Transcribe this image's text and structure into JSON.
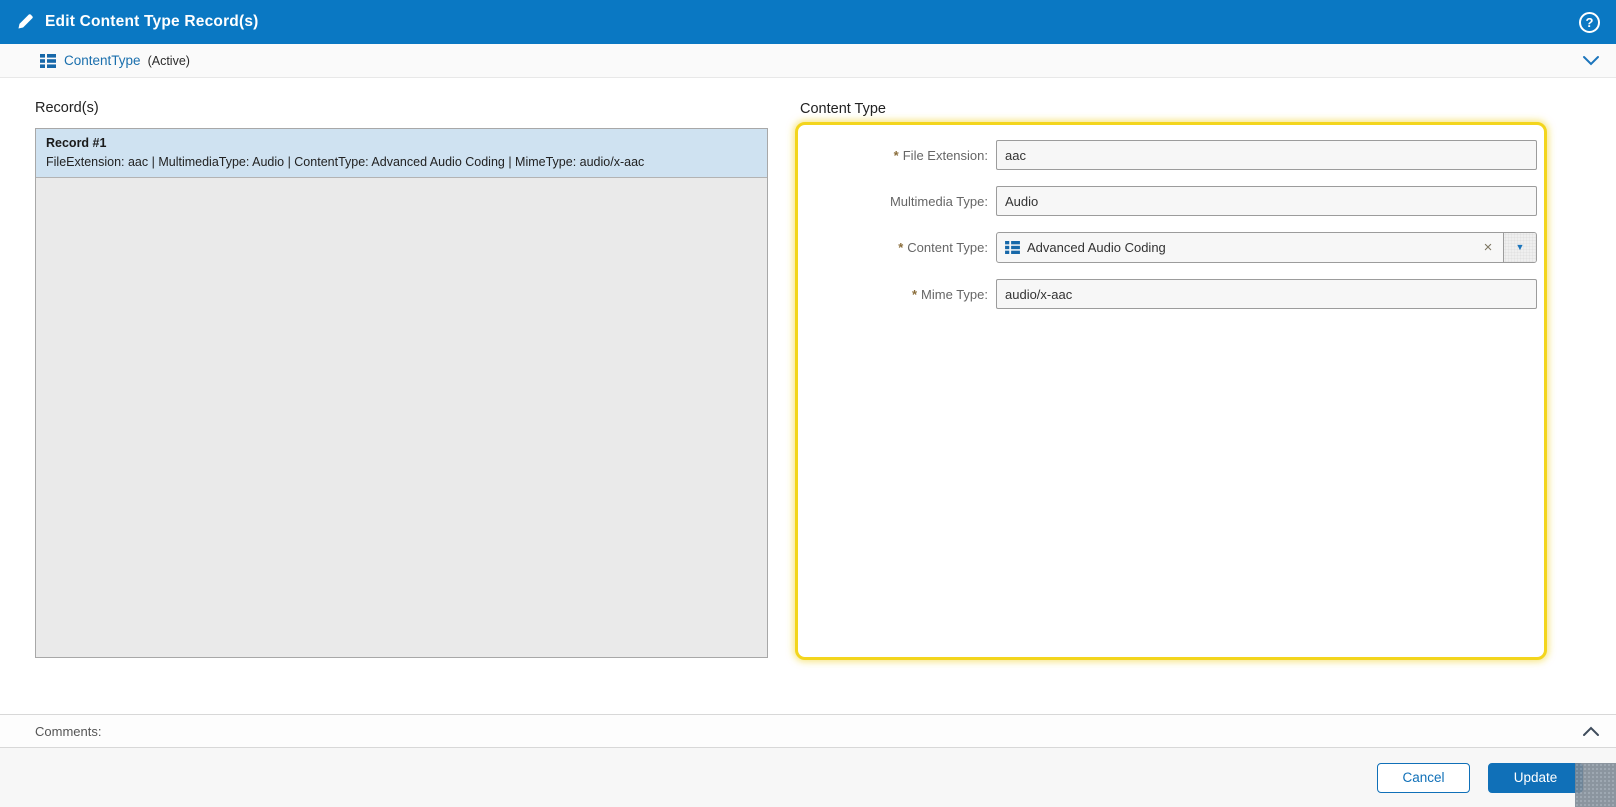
{
  "titlebar": {
    "title": "Edit Content Type Record(s)",
    "help_glyph": "?"
  },
  "subheader": {
    "name": "ContentType",
    "status": "(Active)"
  },
  "records": {
    "heading": "Record(s)",
    "items": [
      {
        "title": "Record #1",
        "summary": "FileExtension: aac | MultimediaType: Audio | ContentType: Advanced Audio Coding | MimeType: audio/x-aac"
      }
    ]
  },
  "form": {
    "heading": "Content Type",
    "fields": [
      {
        "label": "File Extension:",
        "marker": "*",
        "value": "aac",
        "type": "text"
      },
      {
        "label": "Multimedia Type:",
        "marker": "",
        "value": "Audio",
        "type": "text"
      },
      {
        "label": "Content Type:",
        "marker": "*",
        "value": "Advanced Audio Coding",
        "type": "lookup"
      },
      {
        "label": "Mime Type:",
        "marker": "*",
        "value": "audio/x-aac",
        "type": "text"
      }
    ],
    "lookup": {
      "clear_glyph": "×",
      "dropdown_glyph": "▼"
    }
  },
  "comments": {
    "label": "Comments:"
  },
  "footer": {
    "cancel_label": "Cancel",
    "update_label": "Update"
  },
  "colors": {
    "titlebar_blue": "#0a78c3",
    "link_blue": "#1a6fad",
    "selection_blue": "#cfe2f1",
    "highlight_yellow": "#f3d51d",
    "button_blue": "#1070b8",
    "required_marker": "#8a6d3b"
  }
}
